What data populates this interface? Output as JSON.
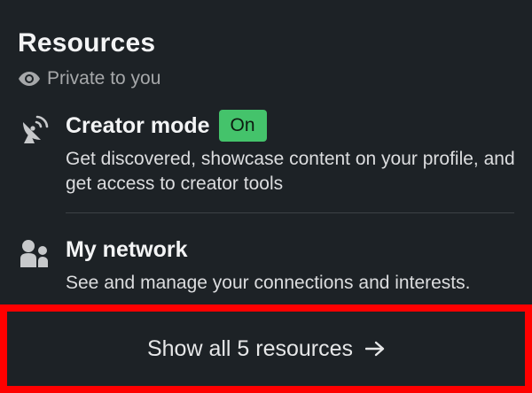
{
  "resources": {
    "title": "Resources",
    "visibility": "Private to you",
    "items": [
      {
        "icon": "satellite-dish-icon",
        "name": "Creator mode",
        "badge": "On",
        "description": "Get discovered, showcase content on your profile, and get access to creator tools"
      },
      {
        "icon": "people-icon",
        "name": "My network",
        "description": "See and manage your connections and interests."
      }
    ],
    "show_all_label": "Show all 5 resources",
    "show_all_icon": "arrow-right-icon"
  },
  "colors": {
    "background": "#1d2226",
    "badge": "#44c36b",
    "highlight_border": "#ff0000",
    "muted_text": "#a6a8aa"
  }
}
